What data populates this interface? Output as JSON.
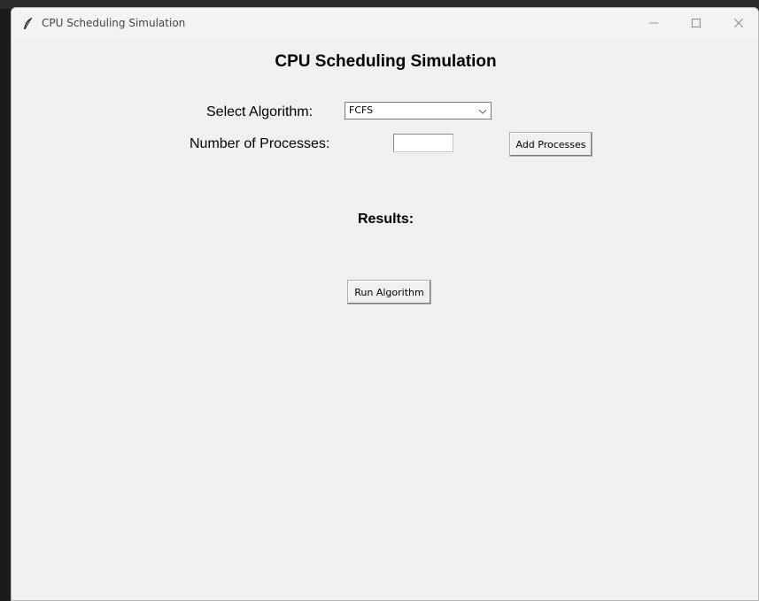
{
  "window": {
    "title": "CPU Scheduling Simulation",
    "controls": {
      "minimize": "minimize-icon",
      "maximize": "maximize-icon",
      "close": "close-icon"
    }
  },
  "main": {
    "heading": "CPU Scheduling Simulation",
    "algorithm": {
      "label": "Select Algorithm:",
      "selected": "FCFS"
    },
    "processes": {
      "label": "Number of Processes:",
      "value": "",
      "add_button": "Add Processes"
    },
    "results_label": "Results:",
    "run_button": "Run Algorithm"
  },
  "colors": {
    "window_bg": "#f0f0f0",
    "text": "#000000"
  }
}
